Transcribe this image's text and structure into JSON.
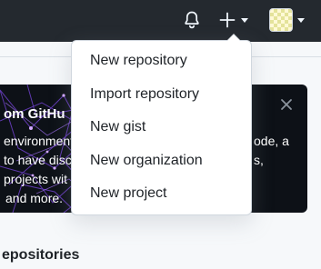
{
  "header": {
    "bell_icon": "bell-icon",
    "create_icon": "plus-icon",
    "avatar_icon": "identicon-avatar",
    "bg_color": "#24292f"
  },
  "create_menu": {
    "items": [
      {
        "label": "New repository"
      },
      {
        "label": "Import repository"
      },
      {
        "label": "New gist"
      },
      {
        "label": "New organization"
      },
      {
        "label": "New project"
      }
    ]
  },
  "banner": {
    "title_fragment": "om GitHu",
    "text_lines_left": [
      "environment",
      "to have disc",
      "projects wit",
      "and more."
    ],
    "text_lines_right": [
      "ode, a",
      "s,"
    ],
    "close_icon": "close-icon",
    "bg_color": "#0d1117"
  },
  "main": {
    "section_title_fragment": "epositories"
  }
}
